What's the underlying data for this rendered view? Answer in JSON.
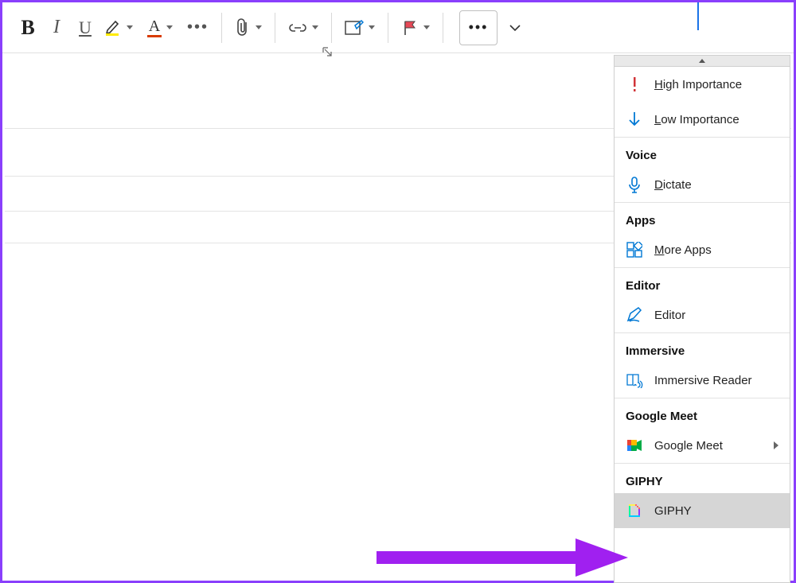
{
  "toolbar": {
    "bold_label": "B",
    "italic_label": "I",
    "underline_label": "U",
    "highlight_label": "Highlight",
    "font_color_label": "A",
    "more_format_label": "More",
    "attach_label": "Attach",
    "link_label": "Link",
    "signature_label": "Signature",
    "flag_label": "Flag",
    "overflow_label": "More options",
    "customize_label": "Customize toolbar"
  },
  "menu": {
    "high_importance": "High Importance",
    "low_importance": "Low Importance",
    "voice_header": "Voice",
    "dictate": "Dictate",
    "apps_header": "Apps",
    "more_apps": "More Apps",
    "editor_header": "Editor",
    "editor": "Editor",
    "immersive_header": "Immersive",
    "immersive_reader": "Immersive Reader",
    "google_meet_header": "Google Meet",
    "google_meet": "Google Meet",
    "giphy_header": "GIPHY",
    "giphy": "GIPHY"
  },
  "annotation": {
    "arrow_color": "#a020f0"
  }
}
